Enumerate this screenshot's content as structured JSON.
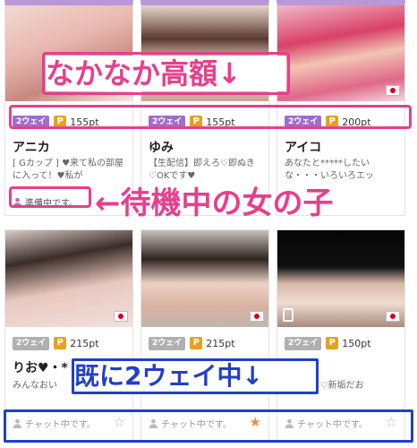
{
  "cards": [
    {
      "way": "2ウェイ",
      "p": "P",
      "points": "155pt",
      "name": "アニカ",
      "desc": "[ Gカップ ] ♥来て私の部屋に入って！♥私が",
      "status": "準備中です。"
    },
    {
      "way": "2ウェイ",
      "p": "P",
      "points": "155pt",
      "name": "ゆみ",
      "desc": "【生配信】即えろ♡即ぬき♡OKです♥"
    },
    {
      "way": "2ウェイ",
      "p": "P",
      "points": "200pt",
      "name": "アイコ",
      "desc": "あなたと*****したいな・・・いろいろエッ"
    },
    {
      "way": "2ウェイ",
      "p": "P",
      "points": "215pt",
      "name": "りお♥・*",
      "desc": "みんなおい",
      "status": "チャット中です。"
    },
    {
      "way": "2ウェイ",
      "p": "P",
      "points": "215pt",
      "name": "",
      "desc": "海遊な方リ♡交換",
      "status": "チャット中です。"
    },
    {
      "way": "2ウェイ",
      "p": "P",
      "points": "150pt",
      "name": "",
      "desc": "たいひと♡新垢だお",
      "status": "チャット中です。"
    }
  ],
  "annotations": {
    "top": "なかなか高額↓",
    "middle": "←待機中の女の子",
    "bottom": "既に2ウェイ中↓"
  },
  "colors": {
    "purple": "#9d6ecc",
    "gray": "#b0b0b0",
    "pink_annotation": "#e83e8c",
    "blue_annotation": "#2040c8",
    "point_orange": "#e8a020",
    "favorite": "#f0903a"
  }
}
